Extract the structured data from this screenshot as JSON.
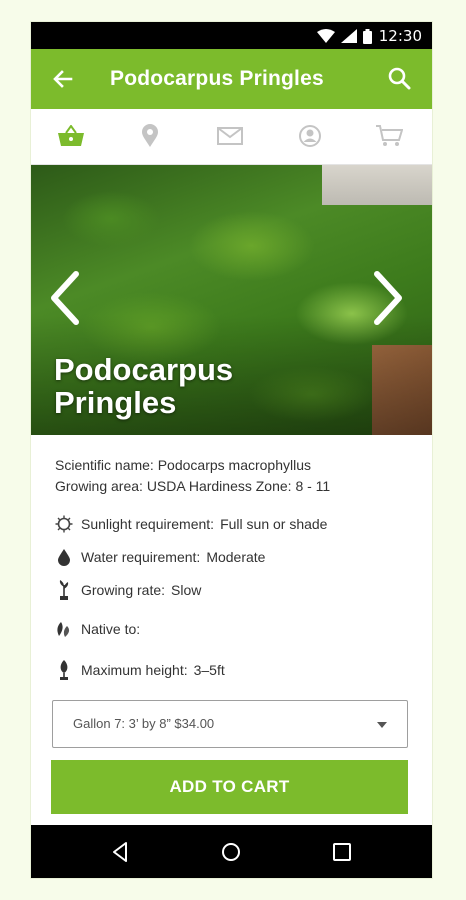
{
  "status_bar": {
    "time": "12:30"
  },
  "app_bar": {
    "title": "Podocarpus Pringles"
  },
  "tabs": [
    {
      "icon": "basket-icon",
      "active": true
    },
    {
      "icon": "location-pin-icon",
      "active": false
    },
    {
      "icon": "mail-icon",
      "active": false
    },
    {
      "icon": "account-icon",
      "active": false
    },
    {
      "icon": "cart-icon",
      "active": false
    }
  ],
  "hero": {
    "plant_name": "Podocarpus Pringles"
  },
  "details": {
    "scientific": "Scientific name:  Podocarps macrophyllus",
    "growing_area": "Growing area:  USDA Hardiness Zone:  8 - 11"
  },
  "specs": {
    "sunlight": {
      "label": "Sunlight requirement:",
      "value": "Full sun or shade"
    },
    "water": {
      "label": "Water requirement:",
      "value": "Moderate"
    },
    "growing_rate": {
      "label": "Growing rate:",
      "value": "Slow"
    },
    "native": {
      "label": "Native to:",
      "value": ""
    },
    "max_height": {
      "label": "Maximum height:",
      "value": "3–5ft"
    }
  },
  "size_select": {
    "selected": "Gallon 7: 3’ by 8” $34.00"
  },
  "add_to_cart": "ADD TO CART",
  "colors": {
    "brand_green": "#7cbb2c",
    "status_bar": "#000000"
  }
}
